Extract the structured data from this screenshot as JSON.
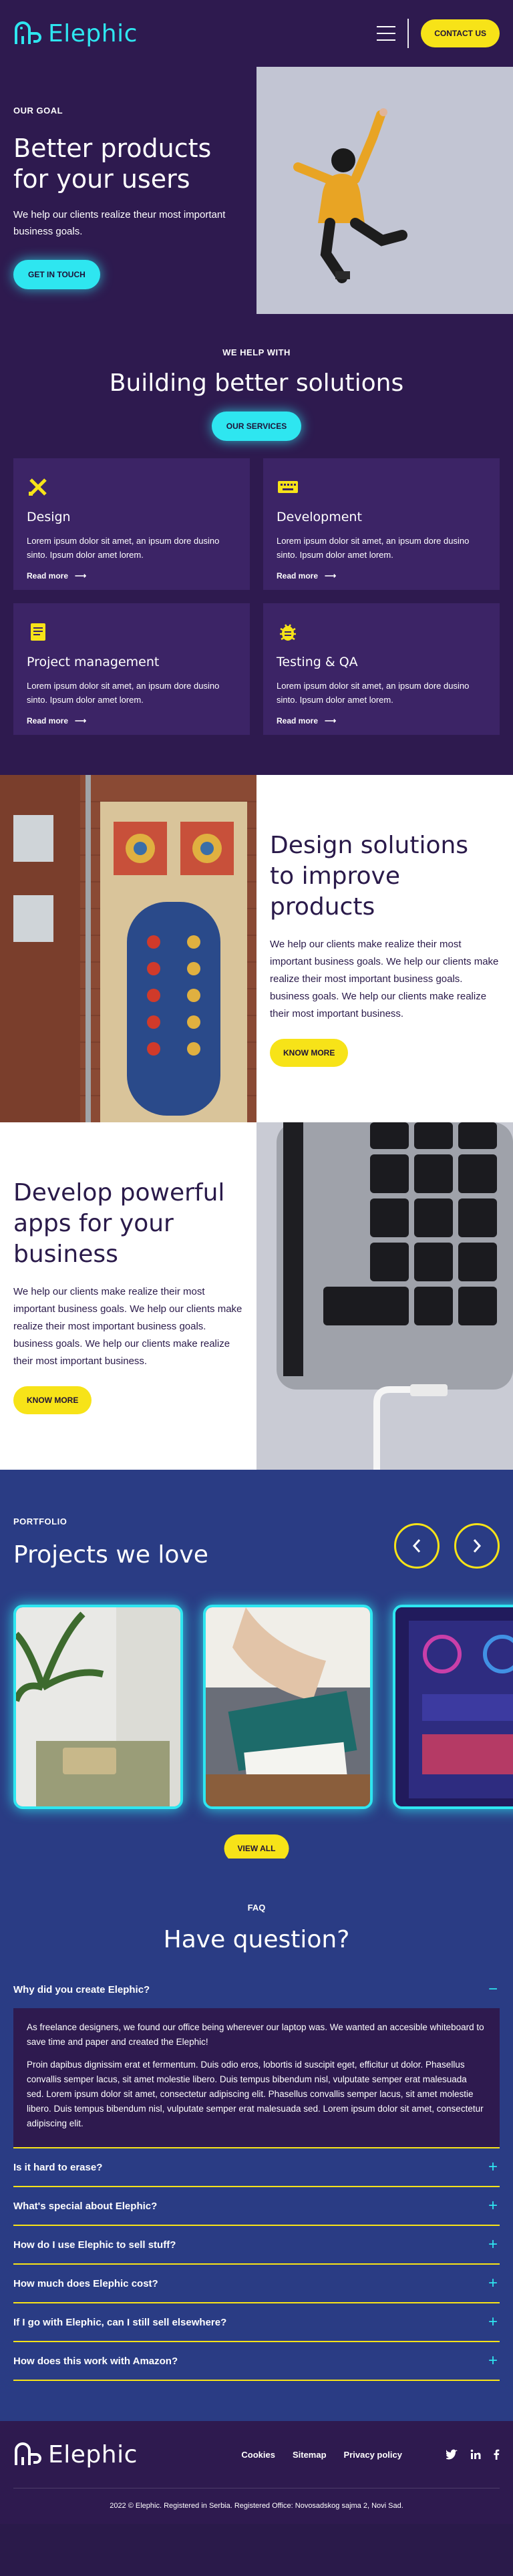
{
  "colors": {
    "primary_dark": "#2e1a4f",
    "accent_cyan": "#2ee6f0",
    "accent_yellow": "#f7e318",
    "portfolio_blue": "#2a3c84"
  },
  "header": {
    "logo_text": "Elephic",
    "contact_label": "CONTACT US"
  },
  "hero": {
    "eyebrow": "OUR GOAL",
    "title": "Better products for your users",
    "description": "We help our clients realize theur most important business goals.",
    "cta": "GET IN TOUCH"
  },
  "services": {
    "eyebrow": "WE HELP WITH",
    "title": "Building better solutions",
    "cta": "OUR SERVICES",
    "items": [
      {
        "name": "Design",
        "icon": "pencil-ruler-icon",
        "desc": "Lorem ipsum dolor sit amet, an ipsum dore dusino sinto. Ipsum dolor amet lorem.",
        "link": "Read more"
      },
      {
        "name": "Development",
        "icon": "keyboard-icon",
        "desc": "Lorem ipsum dolor sit amet, an ipsum dore dusino sinto. Ipsum dolor amet lorem.",
        "link": "Read more"
      },
      {
        "name": "Project management",
        "icon": "clipboard-icon",
        "desc": "Lorem ipsum dolor sit amet, an ipsum dore dusino sinto. Ipsum dolor amet lorem.",
        "link": "Read more"
      },
      {
        "name": "Testing & QA",
        "icon": "bug-icon",
        "desc": "Lorem ipsum dolor sit amet, an ipsum dore dusino sinto. Ipsum dolor amet lorem.",
        "link": "Read more"
      }
    ]
  },
  "design_section": {
    "title": "Design solutions to improve products",
    "description": "We help our clients make realize their most important business goals. We help our clients make realize their most important business goals. business goals. We help our clients make realize their most important business.",
    "cta": "KNOW MORE"
  },
  "develop_section": {
    "title": "Develop powerful apps for your business",
    "description": "We help our clients make realize their most important business goals. We help our clients make realize their most important business goals. business goals. We help our clients make realize their most important business.",
    "cta": "KNOW MORE"
  },
  "portfolio": {
    "eyebrow": "PORTFOLIO",
    "title": "Projects we love",
    "view_all": "VIEW ALL"
  },
  "faq": {
    "eyebrow": "FAQ",
    "title": "Have question?",
    "open_question": "Why did you create Elephic?",
    "open_answer_1": "As freelance designers, we found our office being wherever our laptop was. We wanted an accesible whiteboard to save time and paper and created the Elephic!",
    "open_answer_2": "Proin dapibus dignissim erat et fermentum. Duis odio eros, lobortis id suscipit eget, efficitur ut dolor. Phasellus convallis semper lacus, sit amet molestie libero. Duis tempus bibendum nisl, vulputate semper erat malesuada sed. Lorem ipsum dolor sit amet, consectetur adipiscing elit. Phasellus convallis semper lacus, sit amet molestie libero. Duis tempus bibendum nisl, vulputate semper erat malesuada sed. Lorem ipsum dolor sit amet, consectetur adipiscing elit.",
    "questions": [
      "Is it hard to erase?",
      "What's special about Elephic?",
      "How do I use Elephic to sell stuff?",
      "How much does Elephic cost?",
      "If I go with Elephic, can I still sell elsewhere?",
      "How does this work with Amazon?"
    ]
  },
  "footer": {
    "logo_text": "Elephic",
    "links": [
      "Cookies",
      "Sitemap",
      "Privacy policy"
    ],
    "copyright": "2022 © Elephic. Registered in Serbia. Registered Office: Novosadskog sajma 2, Novi Sad."
  }
}
